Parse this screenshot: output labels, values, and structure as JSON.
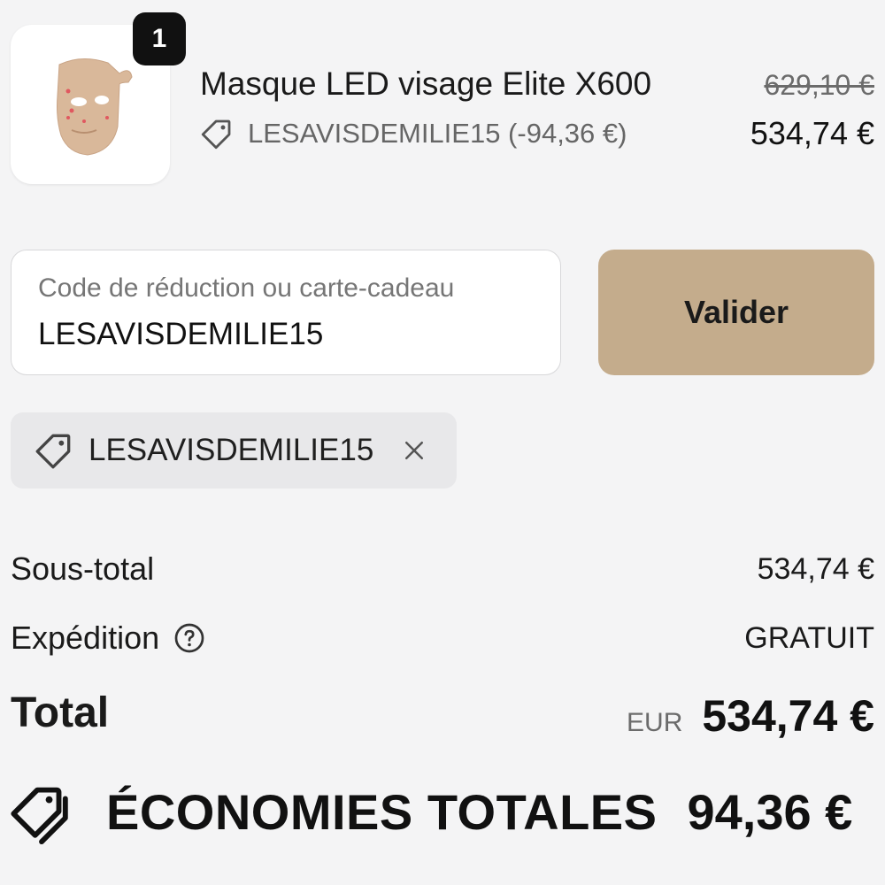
{
  "product": {
    "quantity": "1",
    "name": "Masque LED visage Elite X600",
    "discount_line": "LESAVISDEMILIE15 (-94,36 €)",
    "price_original": "629,10 €",
    "price_current": "534,74 €"
  },
  "discount_form": {
    "label": "Code de réduction ou carte-cadeau",
    "value": "LESAVISDEMILIE15",
    "button_label": "Valider"
  },
  "applied_code": {
    "code": "LESAVISDEMILIE15"
  },
  "summary": {
    "subtotal_label": "Sous-total",
    "subtotal_value": "534,74 €",
    "shipping_label": "Expédition",
    "shipping_value": "GRATUIT",
    "total_label": "Total",
    "total_currency": "EUR",
    "total_value": "534,74 €"
  },
  "savings": {
    "label": "ÉCONOMIES TOTALES",
    "value": "94,36 €"
  },
  "icons": {
    "product_image": "led-face-mask-image",
    "tag": "tag-icon",
    "remove": "close-icon",
    "help": "question-circle-icon",
    "savings": "tags-icon"
  },
  "colors": {
    "background": "#f4f4f5",
    "button": "#c4ac8c",
    "badge": "#111111",
    "chip": "#e8e8ea",
    "mask": "#d9b89a"
  }
}
